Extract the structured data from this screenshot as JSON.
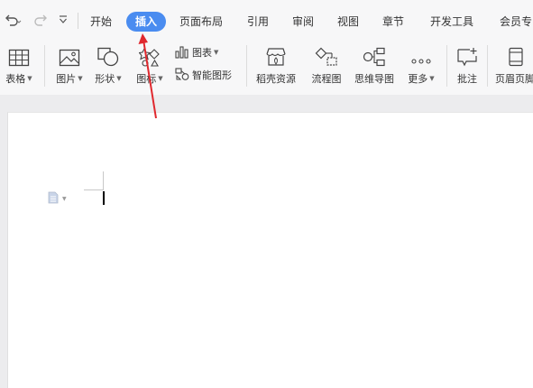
{
  "quick_access": {
    "undo_icon": "undo-icon",
    "redo_icon": "redo-icon",
    "customize_icon": "customize-quick-access-icon"
  },
  "tabs": [
    {
      "label": "开始"
    },
    {
      "label": "插入",
      "active": true
    },
    {
      "label": "页面布局"
    },
    {
      "label": "引用"
    },
    {
      "label": "审阅"
    },
    {
      "label": "视图"
    },
    {
      "label": "章节"
    },
    {
      "label": "开发工具"
    },
    {
      "label": "会员专"
    }
  ],
  "ribbon": {
    "table": "表格",
    "picture": "图片",
    "shape": "形状",
    "icon": "图标",
    "chart": "图表",
    "smart_graphic": "智能图形",
    "daoke_resources": "稻壳资源",
    "flowchart": "流程图",
    "mindmap": "思维导图",
    "more": "更多",
    "comment": "批注",
    "header_footer": "页眉页脚"
  },
  "colors": {
    "accent": "#4a8cf0",
    "annotation_arrow": "#e0282e"
  }
}
